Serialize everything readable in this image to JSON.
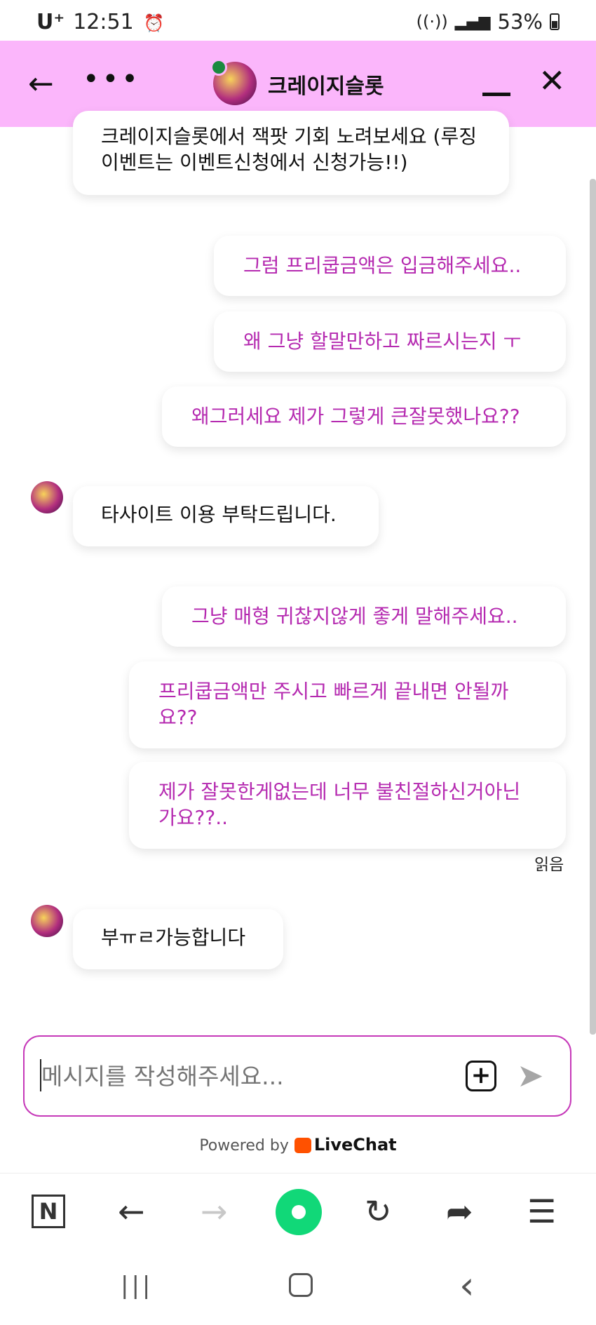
{
  "status_bar": {
    "carrier": "U⁺",
    "time": "12:51",
    "alarm_icon": "alarm-clock-icon",
    "signal_icons": "wifi-icon signal-icon",
    "battery": "53%"
  },
  "header": {
    "title": "크레이지슬롯",
    "back_icon": "back-arrow-icon",
    "more_icon": "more-dots-icon",
    "minimize_icon": "minimize-icon",
    "close_icon": "close-icon"
  },
  "messages": [
    {
      "from": "agent",
      "text": "크레이지슬롯에서 잭팟 기회 노려보세요 (루징이벤트는 이벤트신청에서 신청가능!!)"
    },
    {
      "from": "visitor",
      "text": "그럼 프리쿱금액은 입금해주세요.."
    },
    {
      "from": "visitor",
      "text": "왜 그냥 할말만하고 짜르시는지 ㅜ"
    },
    {
      "from": "visitor",
      "text": "왜그러세요 제가 그렇게 큰잘못했나요??"
    },
    {
      "from": "agent",
      "text": "타사이트 이용 부탁드립니다."
    },
    {
      "from": "visitor",
      "text": "그냥 매형 귀찮지않게 좋게 말해주세요.."
    },
    {
      "from": "visitor",
      "text": "프리쿱금액만 주시고 빠르게 끝내면 안될까요??"
    },
    {
      "from": "visitor",
      "text": "제가 잘못한게없는데 너무 불친절하신거아닌가요??.."
    },
    {
      "from": "agent",
      "text": "부ㅠㄹ가능합니다"
    }
  ],
  "read_receipt": "읽음",
  "composer": {
    "placeholder": "메시지를 작성해주세요...",
    "attach_label": "+",
    "send_icon": "send-icon"
  },
  "footer": {
    "powered_by": "Powered by",
    "brand": "LiveChat"
  },
  "browser_bar": {
    "n_label": "N",
    "back": "←",
    "forward": "→",
    "reload": "↻",
    "share": "➦",
    "menu": "☰"
  },
  "system_nav": {
    "recents": "|||",
    "back": "‹"
  },
  "colors": {
    "header_bg": "#fbb6fb",
    "visitor_text": "#b52ab0",
    "input_border": "#c639b9",
    "livechat_orange": "#ff5100",
    "whale_green": "#11d878"
  }
}
